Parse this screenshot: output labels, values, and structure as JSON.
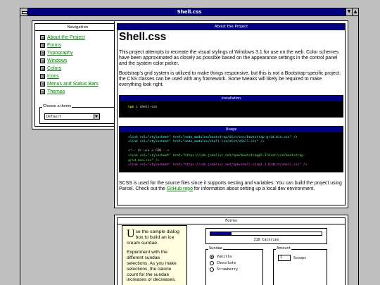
{
  "window": {
    "title": "Shell.css",
    "minimize_glyph": "▼",
    "maximize_glyph": "▲"
  },
  "nav": {
    "title": "Navigation",
    "items": [
      {
        "label": "About the Project"
      },
      {
        "label": "Forms"
      },
      {
        "label": "Typography"
      },
      {
        "label": "Windows"
      },
      {
        "label": "Colors"
      },
      {
        "label": "Icons"
      },
      {
        "label": "Menus and Status Bars"
      },
      {
        "label": "Themes"
      }
    ],
    "theme_group_label": "Choose a theme",
    "theme_selected": "Default"
  },
  "about": {
    "title": "About the Project",
    "heading": "Shell.css",
    "paragraph1": "This project attempts to recreate the visual stylings of Windows 3.1 for use on the web. Color schemes have been approximated as closely as possible based on the appearance settings in the control panel and the system color picker.",
    "paragraph2": "Bootstrap's grid system is utilized to make things responsive, but this is not a Bootstrap-specific project; the CSS classes can be used with any framework. Some tweaks will likely be required to make everything look right.",
    "installation": {
      "title": "Installation",
      "cmd_npm": "npm",
      "cmd_rest": " i shell-css"
    },
    "usage": {
      "title": "Usage",
      "line1": "<link rel=\"stylesheet\" href=\"node_modules/bootstrap/dist/css/bootstrap-grid.min.css\" />",
      "line2": "<link rel=\"stylesheet\" href=\"node_modules/shell-css/dist/shell.css\" />",
      "line3": "<!-- Or use a CDN -->",
      "line4": "<link rel=\"stylesheet\" href=\"https://cdn.jsdelivr.net/npm/bootstrap@5.2/dist/css/bootstrap-",
      "line5": "grid.min.css\" />",
      "line6": "<link rel=\"stylesheet\" href=\"https://cdn.jsdelivr.net/npm/shell-css@1.1.0/dist/shell.css\" />"
    },
    "footer_before": "SCSS is used for the source files since it supports nesting and variables. You can build the project using Parcel. Check out the ",
    "footer_link": "GitHub repo",
    "footer_after": " for information about setting up a local dev environment."
  },
  "forms": {
    "title": "Forms",
    "card": {
      "drop_cap": "U",
      "lead": "se the sample dialog box to build an ice cream sundae.",
      "body": "Experiment with the different sundae selections. As you make selections, the calorie count for the sundae increases or decreases."
    },
    "progress": {
      "fraction": 0.19,
      "label": "310 Calories"
    },
    "sundae": {
      "label": "Sundae",
      "options": [
        {
          "label": "Vanilla",
          "checked": true
        },
        {
          "label": "Chocolate",
          "checked": false
        },
        {
          "label": "Strawberry",
          "checked": false
        }
      ]
    },
    "amount": {
      "label": "Amount",
      "value": "1",
      "unit": "Scoops"
    }
  },
  "colors": {
    "title_bar": "#000080",
    "workspace": "#c0c0c0",
    "link": "#008000",
    "card_bg": "#ffffe0"
  }
}
